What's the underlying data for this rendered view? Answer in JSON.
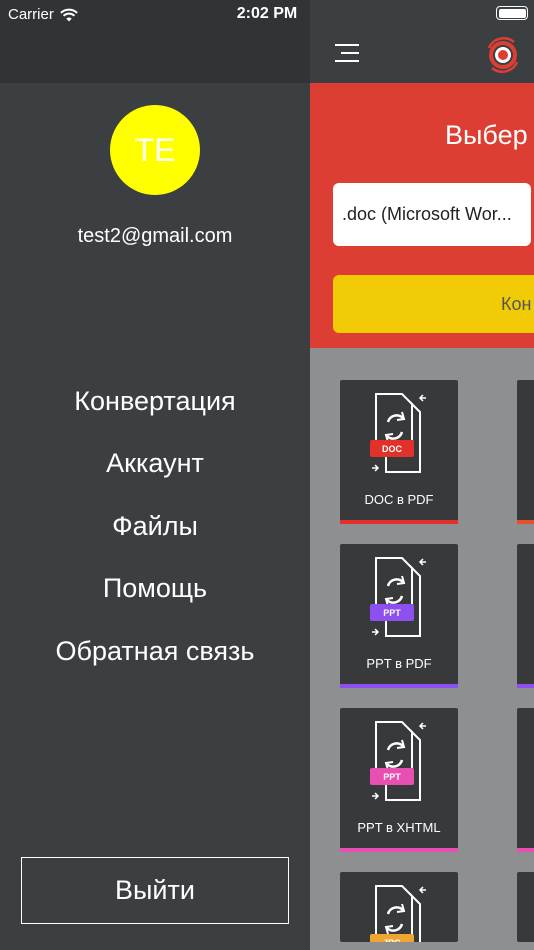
{
  "status_bar": {
    "carrier": "Carrier",
    "time": "2:02 PM"
  },
  "drawer": {
    "avatar_initials": "TE",
    "avatar_color": "#ffff00",
    "email": "test2@gmail.com",
    "menu": [
      {
        "label": "Конвертация"
      },
      {
        "label": "Аккаунт"
      },
      {
        "label": "Файлы"
      },
      {
        "label": "Помощь"
      },
      {
        "label": "Обратная связь"
      }
    ],
    "logout_label": "Выйти"
  },
  "main": {
    "title_partial": "Выбер",
    "format_value": ".doc (Microsoft Wor...",
    "convert_partial": "Кон",
    "accent_red": "#dd3e33",
    "accent_yellow": "#f1cc06",
    "tiles": [
      {
        "badge": "DOC",
        "label": "DOC в PDF",
        "color": "#e2302b"
      },
      {
        "badge": "PPT",
        "label": "PPT в PDF",
        "color": "#8c4ff0"
      },
      {
        "badge": "PPT",
        "label": "PPT в XHTML",
        "color": "#e94fb0"
      },
      {
        "badge": "JPG",
        "label": "",
        "color": "#f0a531"
      }
    ]
  }
}
